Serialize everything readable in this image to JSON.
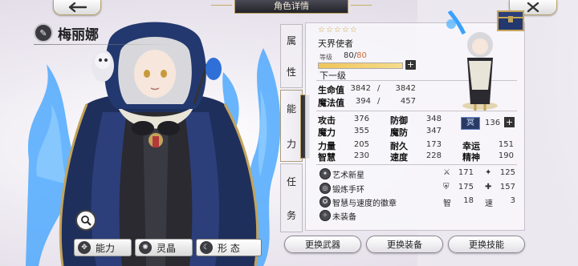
{
  "title": "角色详情",
  "character": {
    "name": "梅丽娜"
  },
  "side_tabs": [
    {
      "chars": [
        "属",
        "性"
      ]
    },
    {
      "chars": [
        "能",
        "力"
      ]
    },
    {
      "chars": [
        "任",
        "务"
      ]
    }
  ],
  "profile": {
    "stars": "☆☆☆☆☆",
    "class_name": "天界使者",
    "level_label": "等级",
    "level_current": "80",
    "level_sep": "/",
    "level_max": "80",
    "level_progress": 1.0,
    "next_level_label": "下一级"
  },
  "vitals": [
    {
      "label": "生命值",
      "current": "3842",
      "sep": "/",
      "max": "3842"
    },
    {
      "label": "魔法值",
      "current": "394",
      "sep": "/",
      "max": "457"
    }
  ],
  "stats": [
    {
      "label": "攻击",
      "value": "376"
    },
    {
      "label": "防御",
      "value": "348"
    },
    {
      "label": "魔力",
      "value": "355"
    },
    {
      "label": "魔防",
      "value": "347"
    },
    {
      "label": "力量",
      "value": "205"
    },
    {
      "label": "耐久",
      "value": "173"
    },
    {
      "label": "幸运",
      "value": "151"
    },
    {
      "label": "智慧",
      "value": "230"
    },
    {
      "label": "速度",
      "value": "228"
    },
    {
      "label": "精神",
      "value": "190"
    }
  ],
  "rank": {
    "badge": "冥",
    "value": "136"
  },
  "equipment": [
    {
      "name": "艺术新星",
      "s1": "⚔",
      "v1": "171",
      "s2": "✦",
      "v2": "125"
    },
    {
      "name": "锻炼手环",
      "s1": "⛨",
      "v1": "175",
      "s2": "✚",
      "v2": "157"
    },
    {
      "name": "智慧与速度的徽章",
      "s1": "智",
      "v1": "18",
      "s2": "速",
      "v2": "3"
    },
    {
      "name": "未装备"
    }
  ],
  "bottom_tabs": [
    {
      "label": "能力"
    },
    {
      "label": "灵晶"
    },
    {
      "label": "形 态"
    }
  ],
  "actions": [
    {
      "label": "更换武器"
    },
    {
      "label": "更换装备"
    },
    {
      "label": "更换技能"
    }
  ],
  "icons": {
    "back": "arrow-left-icon",
    "close": "close-icon",
    "search": "magnifier-icon",
    "name": "class-emblem-icon",
    "plus": "plus-icon"
  },
  "colors": {
    "accent_gold": "#c4a35a",
    "level_max": "#d06a3a",
    "flame_blue": "#3aa0ff"
  }
}
